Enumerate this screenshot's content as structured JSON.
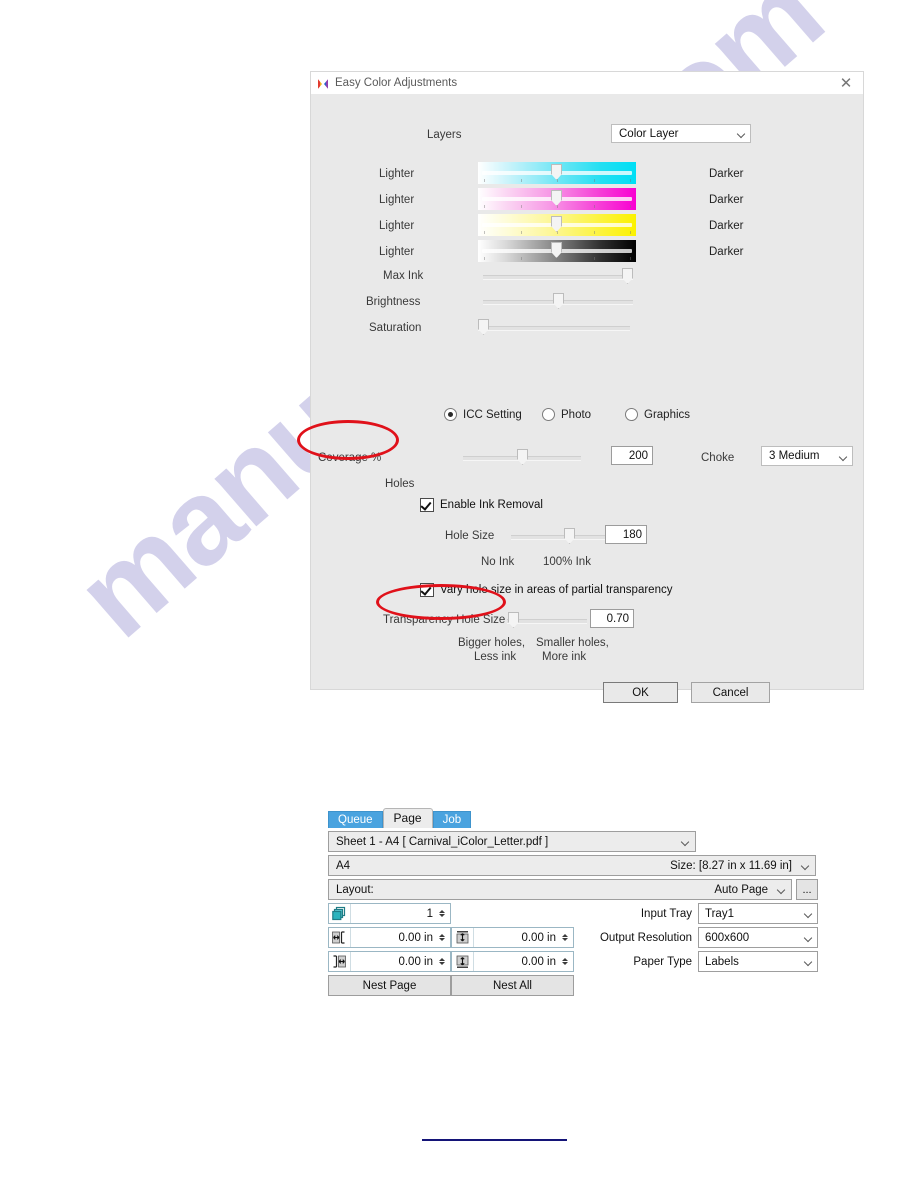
{
  "page": {
    "watermark": "manualslive.com"
  },
  "dialog": {
    "title": "Easy Color Adjustments",
    "close_icon": "close-icon",
    "layers_label": "Layers",
    "layers_value": "Color Layer",
    "channels": [
      {
        "name": "cyan",
        "left_label": "Lighter",
        "right_label": "Darker",
        "value": "0"
      },
      {
        "name": "magenta",
        "left_label": "Lighter",
        "right_label": "Darker",
        "value": "0"
      },
      {
        "name": "yellow",
        "left_label": "Lighter",
        "right_label": "Darker",
        "value": "0"
      },
      {
        "name": "black",
        "left_label": "Lighter",
        "right_label": "Darker",
        "value": "0"
      }
    ],
    "max_ink": {
      "label": "Max Ink",
      "value": "400"
    },
    "brightness": {
      "label": "Brightness",
      "value": "0"
    },
    "saturation": {
      "label": "Saturation",
      "value": "0"
    },
    "render_intent": [
      {
        "label": "ICC Setting",
        "selected": true
      },
      {
        "label": "Photo",
        "selected": false
      },
      {
        "label": "Graphics",
        "selected": false
      }
    ],
    "coverage": {
      "label": "Coverage %",
      "value": "200"
    },
    "choke": {
      "label": "Choke",
      "value": "3 Medium"
    },
    "holes_label": "Holes",
    "enable_ink_removal": {
      "label": "Enable Ink Removal",
      "checked": true
    },
    "hole_size": {
      "label": "Hole Size",
      "value": "180",
      "min_label": "No Ink",
      "max_label": "100% Ink"
    },
    "vary_hole_size": {
      "label": "Vary hole size in areas of partial transparency",
      "checked": true
    },
    "transparency_hole_size": {
      "label": "Transparency Hole Size",
      "value": "0.70",
      "left_line1": "Bigger holes,",
      "left_line2": "Less ink",
      "right_line1": "Smaller holes,",
      "right_line2": "More ink"
    },
    "ok_label": "OK",
    "cancel_label": "Cancel"
  },
  "panel": {
    "tabs": [
      {
        "label": "Queue",
        "active": false
      },
      {
        "label": "Page",
        "active": true
      },
      {
        "label": "Job",
        "active": false
      }
    ],
    "sheet_selector": "Sheet 1 - A4 [ Carnival_iColor_Letter.pdf ]",
    "paper_size": {
      "name": "A4",
      "size": "Size: [8.27 in x 11.69 in]"
    },
    "layout": {
      "label": "Layout:",
      "value": "Auto Page"
    },
    "more_button": "...",
    "copies": "1",
    "offset_left": "0.00 in",
    "offset_top": "0.00 in",
    "offset_right": "0.00 in",
    "offset_bottom": "0.00 in",
    "nest_page": "Nest Page",
    "nest_all": "Nest All",
    "input_tray": {
      "label": "Input Tray",
      "value": "Tray1"
    },
    "output_resolution": {
      "label": "Output Resolution",
      "value": "600x600"
    },
    "paper_type": {
      "label": "Paper Type",
      "value": "Labels"
    }
  },
  "colors": {
    "annotation_red": "#e0111a",
    "tab_blue": "#4aa3df",
    "rule_blue": "#141478"
  }
}
